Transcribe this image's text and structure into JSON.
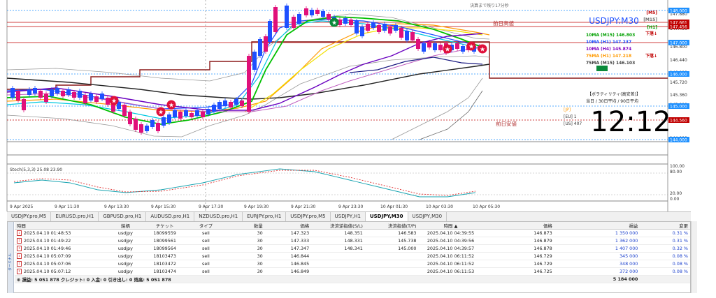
{
  "chart": {
    "symbol_title": "USDJPY:M30",
    "clock": "12:12",
    "top_label": "決算まで残り17分秒",
    "labels": {
      "prev_high_top": "前日高値",
      "prev_high": "前日高値",
      "prev_low": "前日安値"
    },
    "ma_labels": [
      {
        "text": "10MA (M15) 146.803",
        "color": "#00a000"
      },
      {
        "text": "10MA (H1)  147.237",
        "color": "#1e50ff"
      },
      {
        "text": "10MA (H4)  145.874",
        "color": "#8000c0"
      },
      {
        "text": "75MA (H1)  147.218",
        "color": "#ff9900"
      },
      {
        "text": "75MA (M15) 146.103",
        "color": "#404040"
      }
    ],
    "right_tags": [
      {
        "text": "[M5]",
        "color": "#c00000"
      },
      {
        "text": "[M15]",
        "color": "#707070"
      },
      {
        "text": "[H1]",
        "color": "#00a000"
      },
      {
        "text": "下落↓",
        "color": "#c00000"
      },
      {
        "text": "下落↓",
        "color": "#c00000"
      }
    ],
    "volatility": {
      "header": "【ボラティリティ(高安差)】",
      "sub": "当日 / 30日平均 / 90日平均",
      "rows": [
        "[JP]",
        "[EU] 1",
        "[US] 407"
      ]
    },
    "price_labels": [
      "147.880",
      "147.456",
      "147.360",
      "146.800",
      "146.440",
      "146.000",
      "145.720",
      "145.360",
      "145.000",
      "144.000"
    ],
    "price_boxes": [
      {
        "text": "148.000",
        "bg": "#1e90ff"
      },
      {
        "text": "147.661",
        "bg": "#c00000"
      },
      {
        "text": "147.456",
        "bg": "#c00000"
      },
      {
        "text": "147.000",
        "bg": "#1e90ff"
      },
      {
        "text": "146.000",
        "bg": "#1e90ff"
      },
      {
        "text": "145.000",
        "bg": "#1e90ff"
      },
      {
        "text": "144.560",
        "bg": "#c00000"
      },
      {
        "text": "144.000",
        "bg": "#1e90ff"
      }
    ],
    "stoch_label": "Stoch(5,3,3) 25.08 23.90",
    "stoch_scale": [
      "100.00",
      "80.00",
      "20.00",
      "0.00"
    ],
    "time_labels": [
      "9 Apr 2025",
      "9 Apr 11:30",
      "9 Apr 13:30",
      "9 Apr 15:30",
      "9 Apr 17:30",
      "9 Apr 19:30",
      "9 Apr 21:30",
      "9 Apr 23:30",
      "10 Apr 01:30",
      "10 Apr 03:30",
      "10 Apr 05:30"
    ]
  },
  "tabs": [
    "USDJPY.pro,M5",
    "EURUSD.pro,H1",
    "GBPUSD.pro,H1",
    "AUDUSD.pro,H1",
    "NZDUSD.pro,H1",
    "EURJPY.pro,H1",
    "USDJPY.pro,M5",
    "USDJPY,H1",
    "USDJPY,M30",
    "USDJPY,M30"
  ],
  "active_tab": 8,
  "terminal": {
    "sidebar_label": "ターミナル",
    "headers": [
      "時間",
      "銘柄",
      "チケット",
      "タイプ",
      "数量",
      "価格",
      "決済逆指値(S/L)",
      "決済指値(T/P)",
      "時間 ▲",
      "価格",
      "損益",
      "変更"
    ],
    "rows": [
      [
        "2025.04.10 01:48:53",
        "usdjpy",
        "18099559",
        "sell",
        "30",
        "147.323",
        "148.351",
        "146.583",
        "2025.04.10 04:39:55",
        "146.873",
        "1 350 000",
        "0.31 %"
      ],
      [
        "2025.04.10 01:49:22",
        "usdjpy",
        "18099561",
        "sell",
        "30",
        "147.333",
        "148.331",
        "145.738",
        "2025.04.10 04:39:56",
        "146.879",
        "1 362 000",
        "0.31 %"
      ],
      [
        "2025.04.10 01:49:46",
        "usdjpy",
        "18099564",
        "sell",
        "30",
        "147.347",
        "148.341",
        "145.000",
        "2025.04.10 04:39:57",
        "146.878",
        "1 407 000",
        "0.32 %"
      ],
      [
        "2025.04.10 05:07:09",
        "usdjpy",
        "18103473",
        "sell",
        "30",
        "146.844",
        "",
        "",
        "2025.04.10 06:11:52",
        "146.729",
        "345 000",
        "0.08 %"
      ],
      [
        "2025.04.10 05:07:06",
        "usdjpy",
        "18103472",
        "sell",
        "30",
        "146.845",
        "",
        "",
        "2025.04.10 06:11:52",
        "146.729",
        "348 000",
        "0.08 %"
      ],
      [
        "2025.04.10 05:07:12",
        "usdjpy",
        "18103474",
        "sell",
        "30",
        "146.849",
        "",
        "",
        "2025.04.10 06:11:53",
        "146.725",
        "372 000",
        "0.08 %"
      ]
    ],
    "summary": "損益: 5 051 878 クレジット: 0 入金: 0 引き出し: 0 残高: 5 051 878",
    "summary_total": "5 184 000"
  }
}
